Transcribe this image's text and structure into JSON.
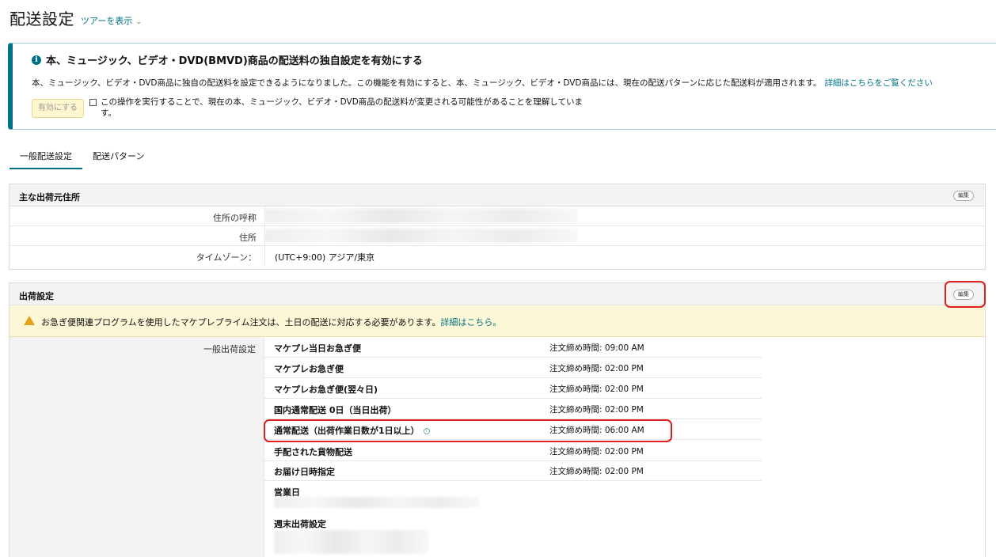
{
  "header": {
    "title": "配送設定",
    "tour_link": "ツアーを表示",
    "tour_chevron": "⌄"
  },
  "notice": {
    "icon": "info-icon",
    "title": "本、ミュージック、ビデオ・DVD(BMVD)商品の配送料の独自設定を有効にする",
    "description": "本、ミュージック、ビデオ・DVD商品に独自の配送料を設定できるようになりました。この機能を有効にすると、本、ミュージック、ビデオ・DVD商品には、現在の配送パターンに応じた配送料が適用されます。",
    "details_link": "詳細はこちらをご覧ください",
    "enable_button": "有効にする",
    "confirm_label": "この操作を実行することで、現在の本、ミュージック、ビデオ・DVD商品の配送料が変更される可能性があることを理解していま す。",
    "confirm_checked": false
  },
  "tabs": [
    {
      "label": "一般配送設定",
      "active": true
    },
    {
      "label": "配送パターン",
      "active": false
    }
  ],
  "address_panel": {
    "title": "主な出荷元住所",
    "edit_label": "編集",
    "rows": [
      {
        "label": "住所の呼称",
        "value": ""
      },
      {
        "label": "住所",
        "value": ""
      },
      {
        "label": "タイムゾーン：",
        "value": "(UTC+9:00) アジア/東京"
      }
    ]
  },
  "shipping_panel": {
    "title": "出荷設定",
    "edit_label": "編集",
    "warning": "お急ぎ便関連プログラムを使用したマケプレプライム注文は、土日の配送に対応する必要があります。",
    "warning_link": "詳細はこちら。",
    "section_label": "一般出荷設定",
    "rows": [
      {
        "name": "マケプレ当日お急ぎ便",
        "cutoff": "注文締め時間: 09:00 AM",
        "info": false
      },
      {
        "name": "マケプレお急ぎ便",
        "cutoff": "注文締め時間: 02:00 PM",
        "info": false
      },
      {
        "name": "マケプレお急ぎ便(翌々日)",
        "cutoff": "注文締め時間: 02:00 PM",
        "info": false
      },
      {
        "name": "国内通常配送 0日（当日出荷）",
        "cutoff": "注文締め時間: 02:00 PM",
        "info": false
      },
      {
        "name": "通常配送（出荷作業日数が1日以上）",
        "cutoff": "注文締め時間: 06:00 AM",
        "info": true
      },
      {
        "name": "手配された貨物配送",
        "cutoff": "注文締め時間: 02:00 PM",
        "info": false
      },
      {
        "name": "お届け日時指定",
        "cutoff": "注文締め時間: 02:00 PM",
        "info": false
      }
    ],
    "business_days_label": "営業日",
    "weekend_label": "週末出荷設定"
  },
  "colors": {
    "accent": "#007185",
    "highlight": "#e02020",
    "warning_bg": "#fcf7d6"
  }
}
